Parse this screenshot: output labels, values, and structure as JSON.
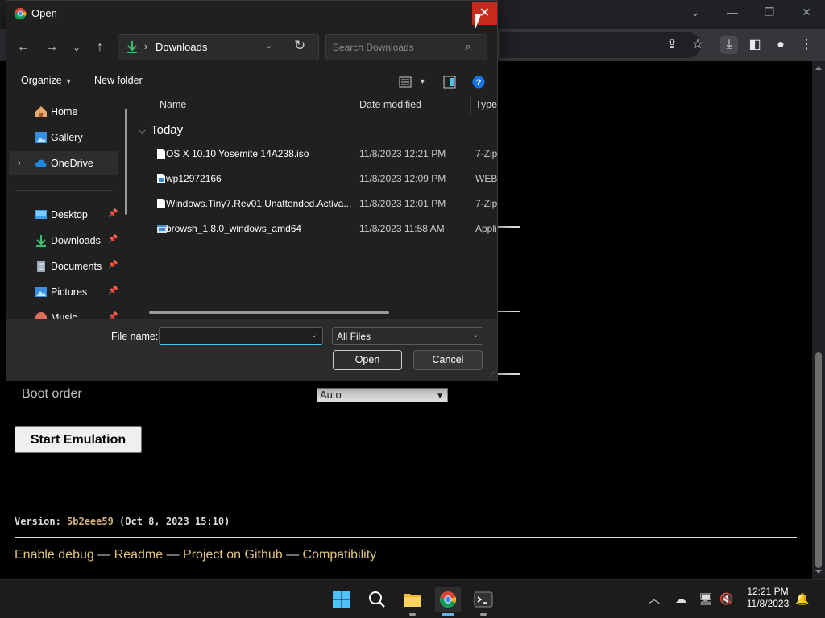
{
  "dialog": {
    "title": "Open",
    "address": {
      "location": "Downloads",
      "separator": "›"
    },
    "search_placeholder": "Search Downloads",
    "toolbar": {
      "organize": "Organize",
      "new_folder": "New folder"
    },
    "nav": {
      "items": [
        {
          "label": "Home"
        },
        {
          "label": "Gallery"
        },
        {
          "label": "OneDrive"
        },
        {
          "label": "Desktop"
        },
        {
          "label": "Downloads"
        },
        {
          "label": "Documents"
        },
        {
          "label": "Pictures"
        },
        {
          "label": "Music"
        }
      ]
    },
    "columns": {
      "name": "Name",
      "date": "Date modified",
      "type": "Type"
    },
    "group": "Today",
    "files": [
      {
        "name": "OS X 10.10 Yosemite 14A238.iso",
        "date": "11/8/2023 12:21 PM",
        "type": "7-Zip"
      },
      {
        "name": "wp12972166",
        "date": "11/8/2023 12:09 PM",
        "type": "WEBP"
      },
      {
        "name": "Windows.Tiny7.Rev01.Unattended.Activa...",
        "date": "11/8/2023 12:01 PM",
        "type": "7-Zip"
      },
      {
        "name": "browsh_1.8.0_windows_amd64",
        "date": "11/8/2023 11:58 AM",
        "type": "Appli"
      }
    ],
    "file_name_label": "File name:",
    "file_name_value": "",
    "file_type": "All Files",
    "open_button": "Open",
    "cancel_button": "Cancel"
  },
  "page": {
    "boot_label": "Boot order",
    "boot_value": "Auto",
    "start_button": "Start Emulation",
    "version_prefix": "Version: ",
    "version_hash": "5b2eee59",
    "version_suffix": " (Oct 8, 2023 15:10)",
    "links": [
      "Enable debug",
      "Readme",
      "Project on Github",
      "Compatibility"
    ],
    "link_separator": " — "
  },
  "taskbar": {
    "time": "12:21 PM",
    "date": "11/8/2023"
  },
  "colors": {
    "accent": "#4cc2ff",
    "close_red": "#c42b1c",
    "link": "#e2c27f"
  }
}
